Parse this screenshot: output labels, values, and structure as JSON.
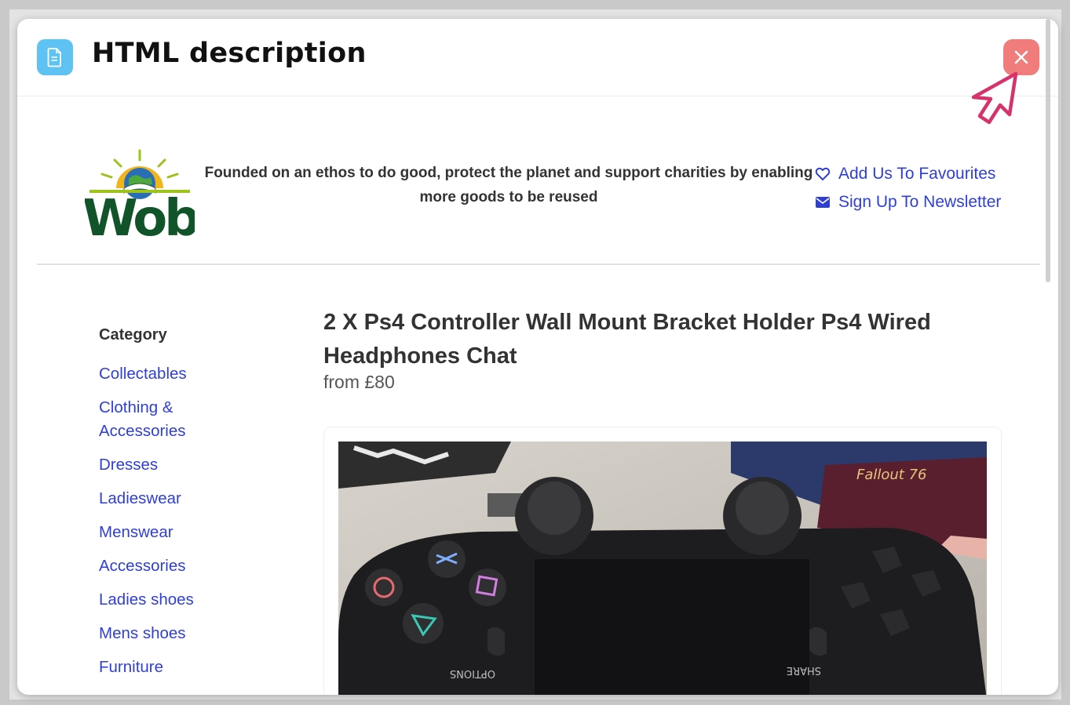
{
  "modal": {
    "title": "HTML description",
    "doc_icon": "document-icon",
    "close_icon": "close-icon",
    "accent_color": "#5ec3f2",
    "close_color": "#f07c7c"
  },
  "header": {
    "logo_text": "Wob",
    "tagline": "Founded on an ethos to do good, protect the planet and support charities by enabling more goods to be reused",
    "links": [
      {
        "label": "Add Us To Favourites",
        "icon": "heart-icon"
      },
      {
        "label": "Sign Up To Newsletter",
        "icon": "envelope-icon"
      }
    ],
    "link_color": "#2f3fd6"
  },
  "sidebar": {
    "title": "Category",
    "items": [
      {
        "label": "Collectables"
      },
      {
        "label": "Clothing & Accessories"
      },
      {
        "label": "Dresses"
      },
      {
        "label": "Ladieswear"
      },
      {
        "label": "Menswear"
      },
      {
        "label": "Accessories"
      },
      {
        "label": "Ladies shoes"
      },
      {
        "label": "Mens shoes"
      },
      {
        "label": "Furniture"
      }
    ]
  },
  "product": {
    "title": "2 X Ps4 Controller Wall Mount Bracket Holder Ps4 Wired Headphones Chat",
    "price": "from £80",
    "photo": {
      "label_left": "OPTIONS",
      "label_right": "SHARE",
      "box_text": "Fallout 76"
    }
  }
}
